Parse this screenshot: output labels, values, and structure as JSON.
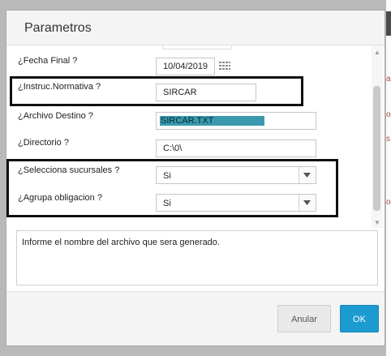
{
  "background": {
    "fragments": [
      "a",
      "o",
      "s",
      "o"
    ]
  },
  "dialog": {
    "title": "Parametros",
    "fields": [
      {
        "label": "¿Fecha Final ?",
        "value": "10/04/2019"
      },
      {
        "label": "¿Instruc.Normativa ?",
        "value": "SIRCAR"
      },
      {
        "label": "¿Archivo Destino ?",
        "value": "SIRCAR.TXT"
      },
      {
        "label": "¿Directorio ?",
        "value": "C:\\0\\"
      },
      {
        "label": "¿Selecciona sucursales ?",
        "value": "Si"
      },
      {
        "label": "¿Agrupa obligacion ?",
        "value": "Si"
      }
    ],
    "help_text": "Informe el nombre del archivo que sera generado.",
    "buttons": {
      "cancel": "Anular",
      "ok": "OK"
    }
  },
  "colors": {
    "ok_button": "#1c9bd1",
    "selected_text": "#3a99ae",
    "highlight_border": "#111111"
  },
  "icons": [
    "calendar-icon",
    "chevron-down-icon",
    "scroll-up-icon",
    "scroll-down-icon"
  ]
}
